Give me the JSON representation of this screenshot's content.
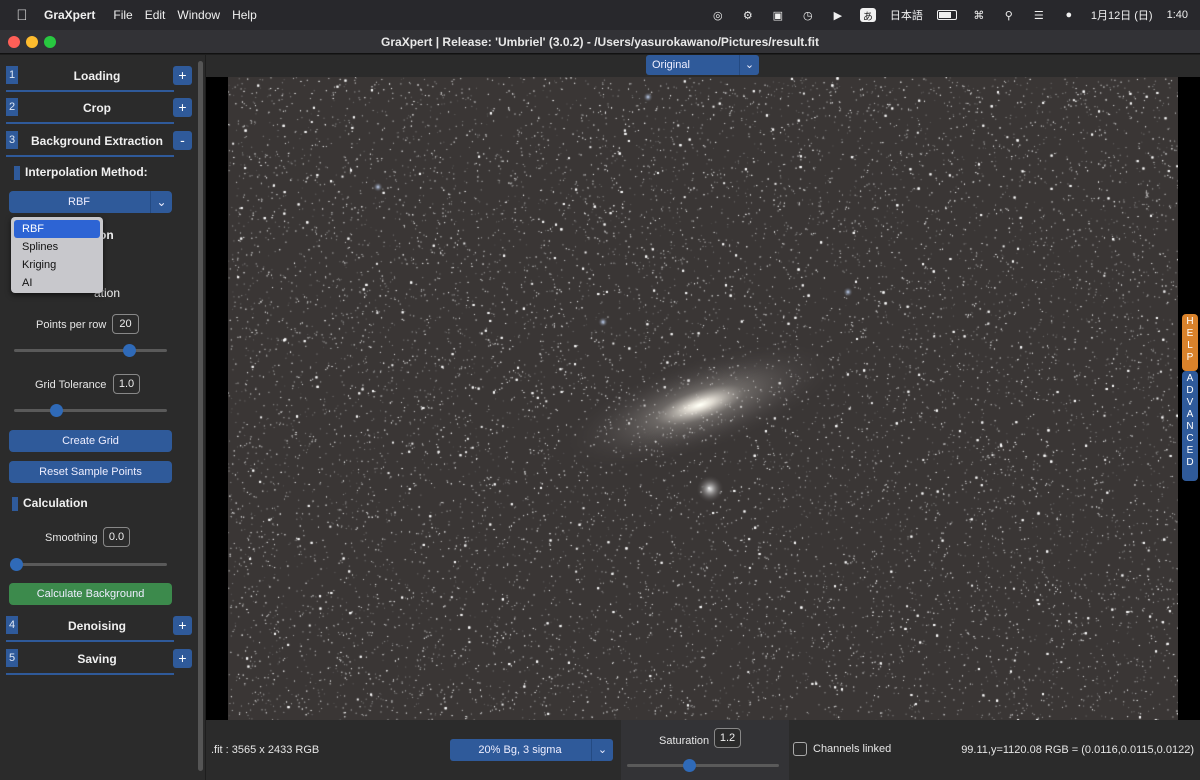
{
  "menubar": {
    "app": "GraXpert",
    "items": [
      "File",
      "Edit",
      "Window",
      "Help"
    ],
    "ime_label": "あ",
    "input_source": "日本語",
    "date": "1月12日 (日)",
    "time": "1:40"
  },
  "window": {
    "title": "GraXpert | Release: 'Umbriel' (3.0.2) - /Users/yasurokawano/Pictures/result.fit"
  },
  "sidebar": {
    "sections": [
      {
        "num": "1",
        "label": "Loading",
        "toggle": "+"
      },
      {
        "num": "2",
        "label": "Crop",
        "toggle": "+"
      },
      {
        "num": "3",
        "label": "Background Extraction",
        "toggle": "-"
      },
      {
        "num": "4",
        "label": "Denoising",
        "toggle": "+"
      },
      {
        "num": "5",
        "label": "Saving",
        "toggle": "+"
      }
    ],
    "interpolation": {
      "label": "Interpolation Method:",
      "value": "RBF",
      "options": [
        "RBF",
        "Splines",
        "Kriging",
        "AI"
      ],
      "hidden_label_1": "on",
      "hidden_label_2": "ation"
    },
    "points_per_row": {
      "label": "Points per row",
      "value": "20",
      "slider_fraction": 0.78
    },
    "grid_tolerance": {
      "label": "Grid Tolerance",
      "value": "1.0",
      "slider_fraction": 0.26
    },
    "create_grid": "Create Grid",
    "reset_points": "Reset Sample Points",
    "calculation": {
      "label": "Calculation"
    },
    "smoothing": {
      "label": "Smoothing",
      "value": "0.0",
      "slider_fraction": 0.0
    },
    "calculate_bg": "Calculate Background"
  },
  "viewer": {
    "view_mode": "Original",
    "help_tab": "HELP",
    "advanced_tab": "ADVANCED"
  },
  "statusbar": {
    "image_info": ".fit : 3565 x 2433 RGB",
    "stretch": "20% Bg, 3 sigma",
    "saturation_label": "Saturation",
    "saturation_value": "1.2",
    "saturation_fraction": 0.4,
    "channels_linked": "Channels linked",
    "coords": "99.11,y=1120.08  RGB = (0.0116,0.0115,0.0122)"
  },
  "colors": {
    "accent_blue": "#2f5a9a",
    "help_orange": "#d9822b",
    "calc_green": "#3c8a4c"
  }
}
